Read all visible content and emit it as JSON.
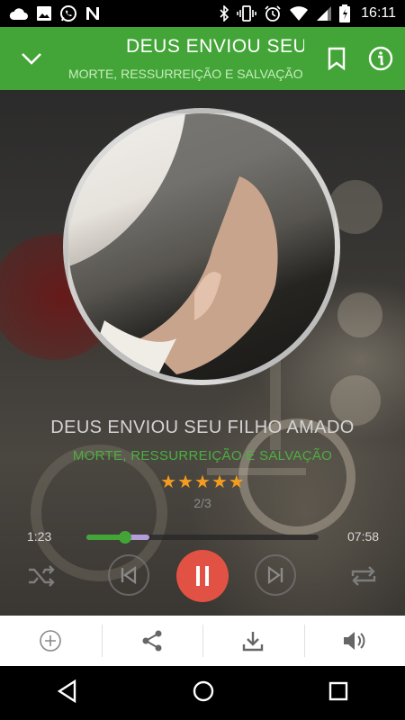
{
  "status_bar": {
    "time": "16:11",
    "left_icons": [
      "cloud-icon",
      "image-icon",
      "whatsapp-icon",
      "n-icon"
    ],
    "right_icons": [
      "bluetooth-icon",
      "vibrate-icon",
      "alarm-icon",
      "wifi-icon",
      "signal-icon",
      "battery-icon"
    ]
  },
  "app_bar": {
    "title": "DEUS ENVIOU SEU FILHO AMADO",
    "subtitle": "MORTE, RESSURREIÇÃO E SALVAÇÃO",
    "color": "#43a537"
  },
  "track": {
    "title": "DEUS ENVIOU SEU FILHO AMADO",
    "album": "MORTE, RESSURREIÇÃO E SALVAÇÃO",
    "rating": 5,
    "rating_stars": [
      "★",
      "★",
      "★",
      "★",
      "★"
    ],
    "index": "2/3"
  },
  "playback": {
    "elapsed": "1:23",
    "total": "07:58",
    "progress": 0.165,
    "buffered": 0.27,
    "state": "playing"
  },
  "controls": [
    "shuffle-icon",
    "previous-icon",
    "pause-icon",
    "next-icon",
    "repeat-icon"
  ],
  "toolbar": [
    "add-icon",
    "share-icon",
    "download-icon",
    "volume-icon"
  ],
  "nav_bar": [
    "back-icon",
    "home-icon",
    "recents-icon"
  ],
  "colors": {
    "accent_green": "#43a537",
    "play_button": "#e25244",
    "stars": "#f39c1f"
  }
}
